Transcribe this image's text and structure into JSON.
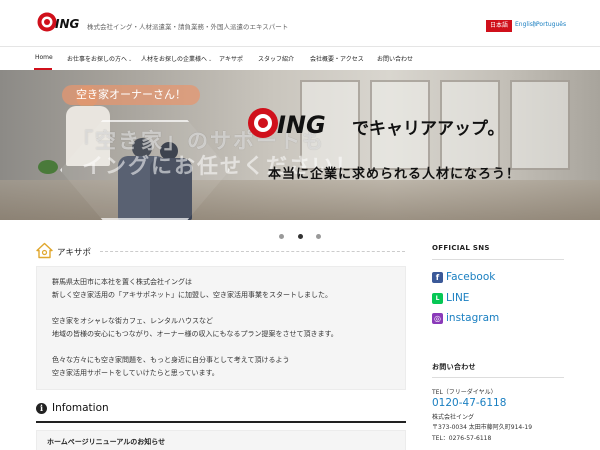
{
  "header": {
    "tagline": "株式会社イング・人材派遣業・請負業務・外国人派遣のエキスパート",
    "lang_ja": "日本語",
    "lang_en": "English",
    "lang_sep": "|",
    "lang_pt": "Português",
    "brand_color": "#d0101b",
    "logo_text": "ING"
  },
  "nav": {
    "items": [
      {
        "label": "Home",
        "has_submenu": false
      },
      {
        "label": "お仕事をお探しの方へ",
        "has_submenu": true
      },
      {
        "label": "人材をお探しの企業様へ",
        "has_submenu": true
      },
      {
        "label": "アキサポ",
        "has_submenu": false
      },
      {
        "label": "スタッフ紹介",
        "has_submenu": false
      },
      {
        "label": "会社概要・アクセス",
        "has_submenu": false
      },
      {
        "label": "お問い合わせ",
        "has_submenu": false
      }
    ],
    "chevron": "⌄"
  },
  "hero": {
    "pill": "空き家オーナーさん！",
    "overlay_line1": "「空き家」のサポートも",
    "overlay_line2": "イングにお任せください！",
    "logo_text": "ING",
    "headline": "でキャリアアップ。",
    "subheadline": "本当に企業に求められる人材になろう！",
    "slide_count": 3,
    "active_slide": 2
  },
  "akisapo": {
    "title": "アキサポ",
    "lines": [
      "群馬県太田市に本社を置く株式会社イングは",
      "新しく空き家活用の「アキサポネット」に加盟し、空き家活用事業をスタートしました。",
      "",
      "空き家をオシャレな街カフェ、レンタルハウスなど",
      "地域の皆様の安心にもつながり、オーナー様の収入にもなるプラン提案をさせて頂きます。",
      "",
      "色々な方々にも空き家問題を、もっと身近に自分事として考えて頂けるよう",
      "空き家活用サポートをしていけたらと思っています。"
    ]
  },
  "information": {
    "icon": "i",
    "title": "Infomation",
    "first_item": "ホームページリニューアルのお知らせ"
  },
  "sidebar": {
    "sns_title": "OFFICIAL SNS",
    "sns": [
      {
        "label": "Facebook",
        "icon": "f",
        "color": "#3b5998"
      },
      {
        "label": "LINE",
        "icon": "L",
        "color": "#06c755"
      },
      {
        "label": "instagram",
        "icon": "◎",
        "color": "#8a3ab9"
      }
    ],
    "contact_title": "お問い合わせ",
    "tel_label": "TEL（フリーダイヤル）",
    "tel": "0120-47-6118",
    "company": "株式会社イング",
    "address": "〒373-0034 太田市藤阿久町914-19",
    "tel2": "TEL：0276-57-6118"
  }
}
